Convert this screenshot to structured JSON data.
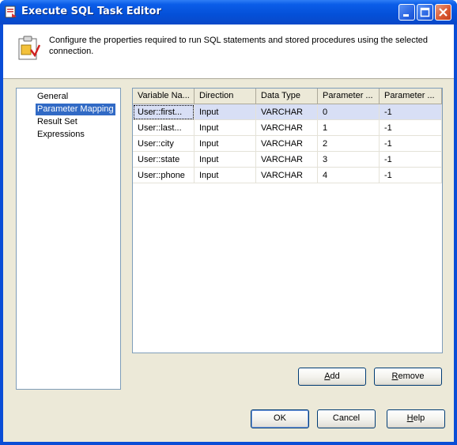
{
  "window": {
    "title": "Execute SQL Task Editor",
    "controls": {
      "minimize_icon": "minimize-icon",
      "maximize_icon": "maximize-icon",
      "close_icon": "close-icon"
    }
  },
  "header": {
    "description": "Configure the properties required to run SQL statements and stored procedures using the selected connection.",
    "icon": "task-properties-icon"
  },
  "nav": {
    "items": [
      {
        "label": "General"
      },
      {
        "label": "Parameter Mapping",
        "selected": true
      },
      {
        "label": "Result Set"
      },
      {
        "label": "Expressions"
      }
    ]
  },
  "grid": {
    "columns": [
      "Variable Na...",
      "Direction",
      "Data Type",
      "Parameter ...",
      "Parameter ..."
    ],
    "rows": [
      [
        "User::first...",
        "Input",
        "VARCHAR",
        "0",
        "-1"
      ],
      [
        "User::last...",
        "Input",
        "VARCHAR",
        "1",
        "-1"
      ],
      [
        "User::city",
        "Input",
        "VARCHAR",
        "2",
        "-1"
      ],
      [
        "User::state",
        "Input",
        "VARCHAR",
        "3",
        "-1"
      ],
      [
        "User::phone",
        "Input",
        "VARCHAR",
        "4",
        "-1"
      ]
    ],
    "selected_row": 0
  },
  "buttons": {
    "add_first": "A",
    "add_rest": "dd",
    "remove_first": "R",
    "remove_rest": "emove",
    "ok": "OK",
    "cancel": "Cancel",
    "help_first": "H",
    "help_rest": "elp"
  },
  "colors": {
    "title_bar": "#0450d8",
    "selection": "#316ac5",
    "dialog_bg": "#ece9d8"
  }
}
